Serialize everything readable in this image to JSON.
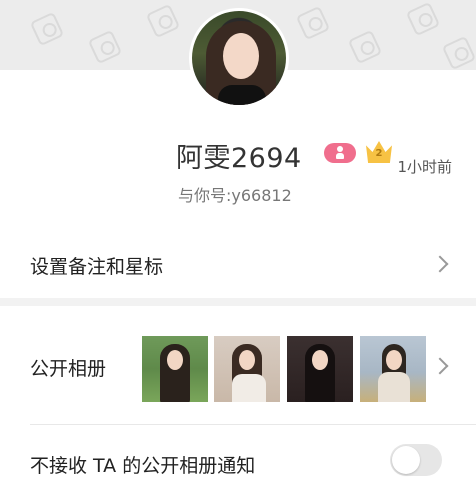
{
  "profile": {
    "time_ago": "1小时前",
    "name": "阿雯2694",
    "wechat_id": "与你号:y66812",
    "crown_level": "2"
  },
  "rows": {
    "remark_label": "设置备注和星标",
    "album_label": "公开相册",
    "notify_label": "不接收 TA 的公开相册通知",
    "notify_enabled": false
  },
  "album": {
    "photos": [
      {
        "desc": "photo-1"
      },
      {
        "desc": "photo-2"
      },
      {
        "desc": "photo-3"
      },
      {
        "desc": "photo-4"
      }
    ]
  },
  "colors": {
    "badge_pink": "#f06e8d",
    "crown_gold": "#f7c244"
  }
}
